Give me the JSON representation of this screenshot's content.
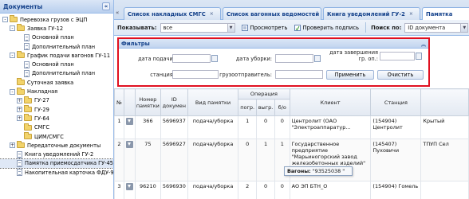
{
  "sidebar": {
    "title": "Документы",
    "collapse_icon": "«",
    "items": [
      {
        "label": "Перевозка грузов с ЭЦП",
        "level": 0,
        "exp": "-",
        "icon": "folder"
      },
      {
        "label": "Заявка ГУ-12",
        "level": 1,
        "exp": "-",
        "icon": "folder"
      },
      {
        "label": "Основной план",
        "level": 2,
        "exp": "",
        "icon": "leaf"
      },
      {
        "label": "Дополнительный план",
        "level": 2,
        "exp": "",
        "icon": "leaf"
      },
      {
        "label": "График подачи вагонов ГУ-11",
        "level": 1,
        "exp": "-",
        "icon": "folder"
      },
      {
        "label": "Основной план",
        "level": 2,
        "exp": "",
        "icon": "leaf"
      },
      {
        "label": "Дополнительный план",
        "level": 2,
        "exp": "",
        "icon": "leaf"
      },
      {
        "label": "Суточная заявка",
        "level": 1,
        "exp": "",
        "icon": "folder"
      },
      {
        "label": "Накладная",
        "level": 1,
        "exp": "-",
        "icon": "folder"
      },
      {
        "label": "ГУ-27",
        "level": 2,
        "exp": "+",
        "icon": "folder"
      },
      {
        "label": "ГУ-29",
        "level": 2,
        "exp": "+",
        "icon": "folder"
      },
      {
        "label": "ГУ-64",
        "level": 2,
        "exp": "+",
        "icon": "folder"
      },
      {
        "label": "СМГС",
        "level": 2,
        "exp": "",
        "icon": "folder"
      },
      {
        "label": "ЦИМ/СМГС",
        "level": 2,
        "exp": "",
        "icon": "folder"
      },
      {
        "label": "Передаточные документы",
        "level": 1,
        "exp": "+",
        "icon": "folder"
      },
      {
        "label": "Книга уведомлений ГУ-2",
        "level": 1,
        "exp": "",
        "icon": "leaf"
      },
      {
        "label": "Памятка приемосдатчика ГУ-45",
        "level": 1,
        "exp": "",
        "icon": "leaf",
        "selected": true
      },
      {
        "label": "Накопительная карточка ФДУ-92",
        "level": 1,
        "exp": "",
        "icon": "leaf"
      }
    ]
  },
  "tabs": {
    "scroll_left": "«",
    "items": [
      {
        "label": "Список накладных СМГС",
        "close": "×"
      },
      {
        "label": "Список вагонных ведомостей",
        "close": "×"
      },
      {
        "label": "Книга уведомлений ГУ-2",
        "close": "×"
      },
      {
        "label": "Памятка",
        "close": "×",
        "active": true
      }
    ]
  },
  "toolbar": {
    "show_label": "Показывать:",
    "show_value": "все",
    "view_label": "Просмотреть",
    "sign_label": "Проверить подпись",
    "search_label": "Поиск по:",
    "search_value": "ID документа"
  },
  "filters": {
    "title": "Фильтры",
    "collapse_icon": "︽",
    "date_delivery_label": "дата подачи:",
    "date_cleanup_label": "дата уборки:",
    "date_finish_label_1": "дата завершения",
    "date_finish_label_2": "гр. оп.:",
    "station_label": "станция:",
    "shipper_label": "грузоотправитель:",
    "apply_label": "Применить",
    "clear_label": "Очистить"
  },
  "grid": {
    "headers": {
      "num": "№",
      "memo_num": "Номер памятки",
      "id_doc": "ID докумен",
      "type": "Вид памятки",
      "operation": "Операция",
      "load": "погр.",
      "unload": "выгр.",
      "bo": "б/о",
      "client": "Клиент",
      "station": "Станция",
      "extra": ""
    },
    "rows": [
      {
        "n": "1",
        "memo": "366",
        "id": "5696937",
        "type": "подача/уборка",
        "load": "1",
        "unload": "0",
        "bo": "0",
        "client": "Центролит (ОАО \"Электроаппаратур...",
        "station": "(154904) Центролит",
        "extra": "Крытый"
      },
      {
        "n": "2",
        "memo": "75",
        "id": "5696927",
        "type": "подача/уборка",
        "load": "0",
        "unload": "1",
        "bo": "1",
        "client": "Государственное предприятие \"Марьиногорский завод железобетонных изделий\" (7434)",
        "station": "(145407) Пуховичи",
        "extra": "ТПУП Сел"
      },
      {
        "n": "3",
        "memo": "96210",
        "id": "5696930",
        "type": "подача/уборка",
        "load": "2",
        "unload": "0",
        "bo": "0",
        "client": "АО ЭП БТН_О",
        "station": "(154904) Гомель",
        "extra": ""
      }
    ]
  },
  "tooltip": {
    "label": "Вагоны:",
    "value": "\"93525038 \""
  }
}
